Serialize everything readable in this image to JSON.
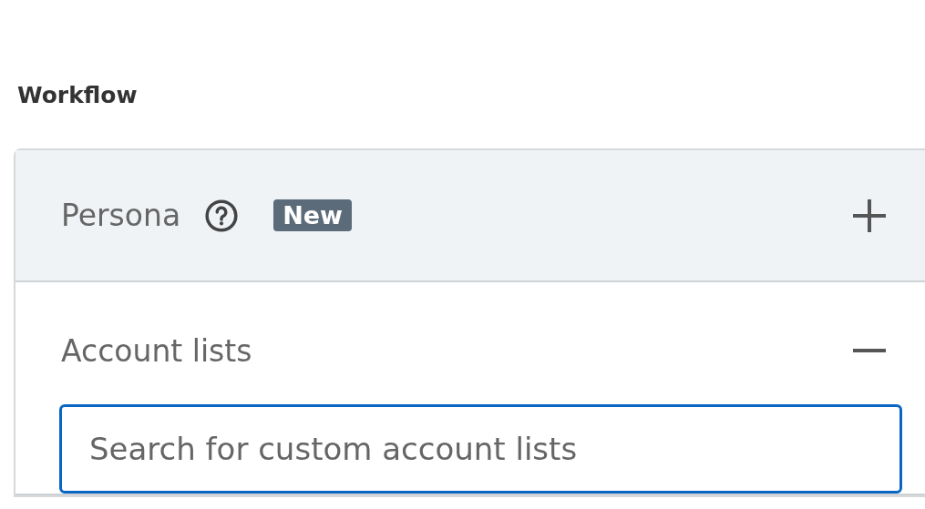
{
  "section_title": "Workflow",
  "groups": [
    {
      "title": "Persona",
      "help": true,
      "badge": "New",
      "expanded": false
    },
    {
      "title": "Account lists",
      "help": false,
      "expanded": true,
      "search": {
        "placeholder": "Search for custom account lists"
      }
    }
  ]
}
